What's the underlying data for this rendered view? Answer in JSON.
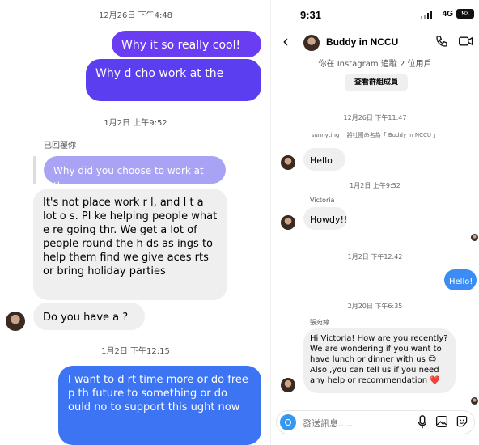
{
  "left": {
    "ts1": "12月26日 下午4:48",
    "msg1": "Why it so   really cool!",
    "msg2": "Why   d   cho    work at the",
    "ts2": "1月2日 上午9:52",
    "replied_label": "已回覆你",
    "quote": "Why did you choose to work at there",
    "msg3": "It's not      place    work r   l, and I   t a   lot  o   s. Pl   ke helping people   what   e re   going thr. We get a lot of people   round the h   ds  as   ings   to help them find   we   give   aces   rts or bring   holiday parties",
    "msg4": "Do you have a   ?",
    "ts3": "1月2日 下午12:15",
    "msg5": "I want to d   rt time    more or do free   p   th   future to   something    or do   ould   no   to support   this   ught now"
  },
  "right": {
    "status": {
      "time": "9:31",
      "network": "4G",
      "battery": "93"
    },
    "header": {
      "title": "Buddy in NCCU"
    },
    "follow_note": "你在 Instagram 追蹤 2 位用戶",
    "members_button": "查看群組成員",
    "ts1": "12月26日 下午11:47",
    "system_note": "sunnyting__ 將社團命名為「 Buddy in NCCU 」",
    "msg_hello": "Hello❤️",
    "ts2": "1月2日 上午9:52",
    "sender_victoria": "Victoria",
    "msg_howdy": "Howdy!!",
    "ts3": "1月2日 下午12:42",
    "msg_hello_out": "Hello!",
    "ts4": "2月20日 下午6:35",
    "sender_zh": "張宛婷",
    "msg_long": "Hi Victoria! How are you recently? We are wondering if you want to have lunch or dinner with us 😊 Also ,you can tell us if you need any help or recommendation ❤️",
    "composer_placeholder": "發送訊息......"
  }
}
